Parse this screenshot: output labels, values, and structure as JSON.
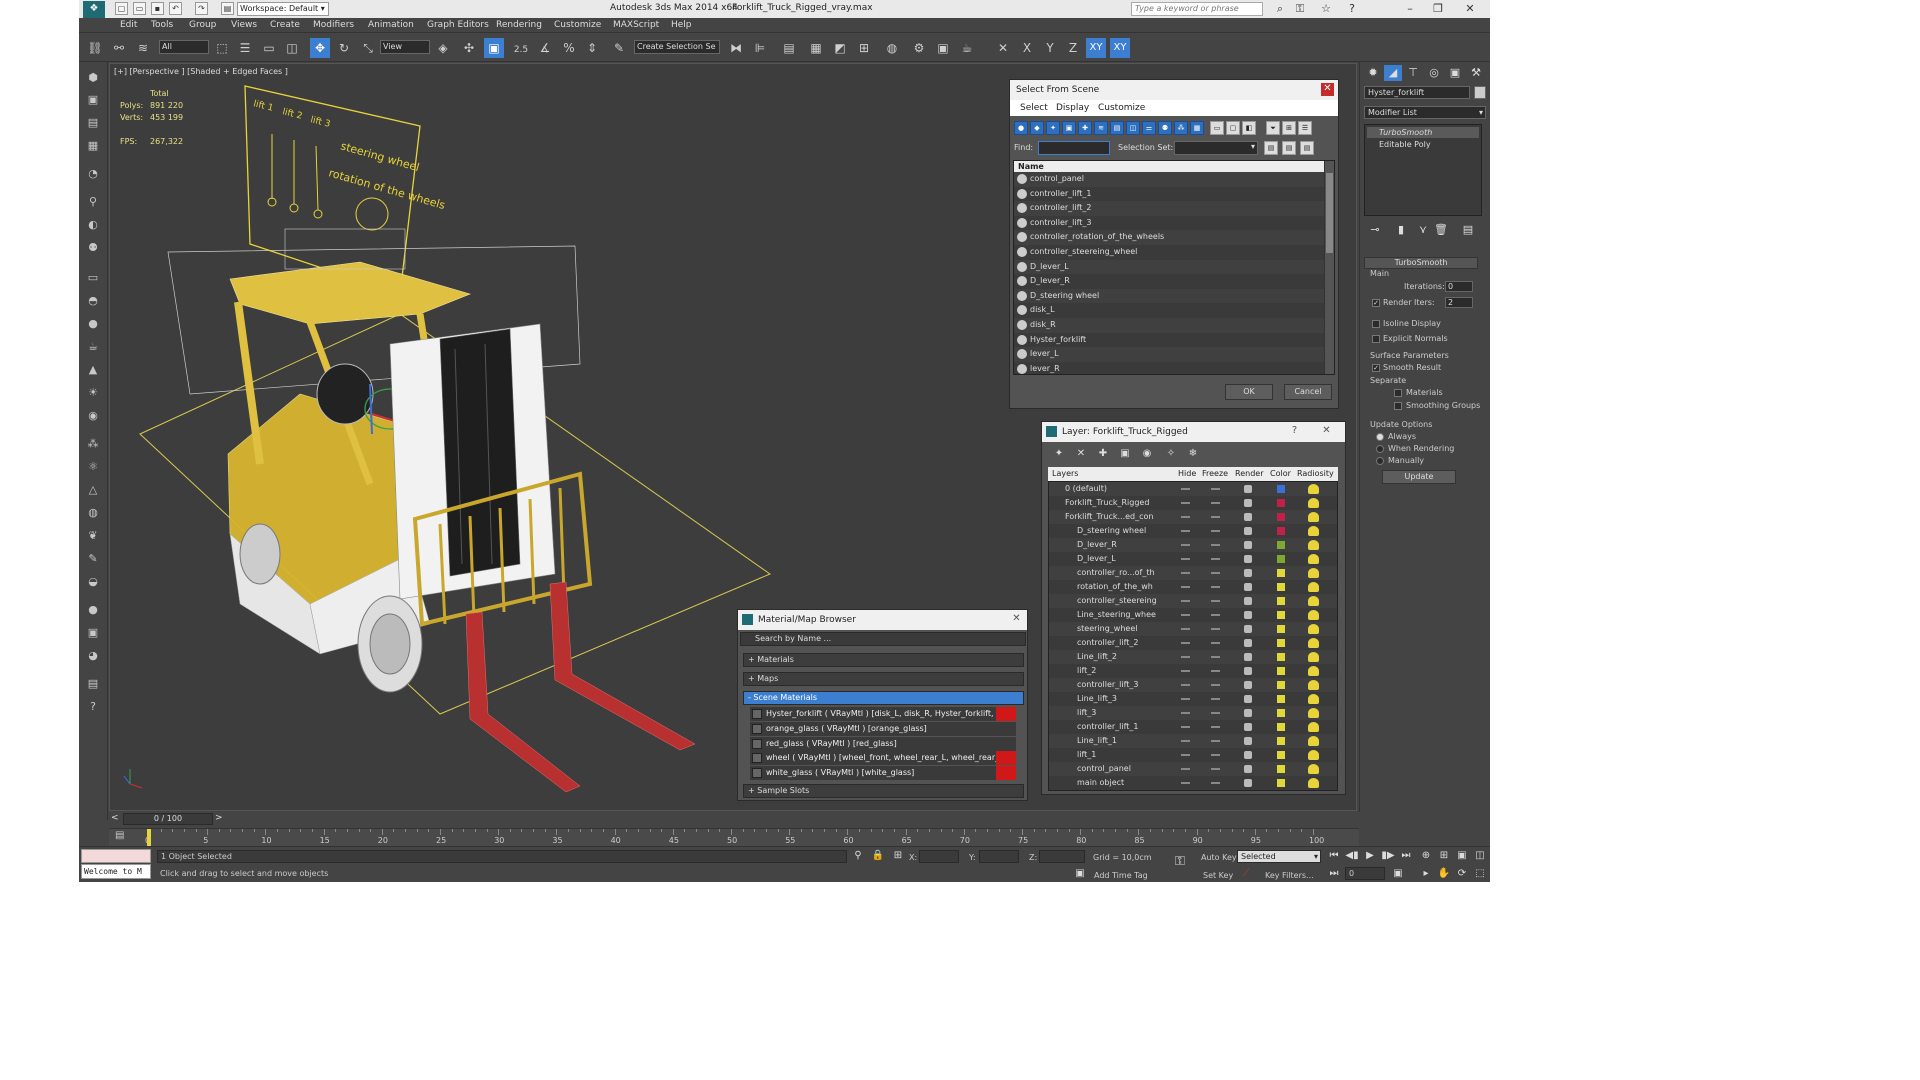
{
  "titlebar": {
    "workspace": "Workspace: Default",
    "app_title": "Autodesk 3ds Max  2014 x64",
    "file": "Forklift_Truck_Rigged_vray.max",
    "search_placeholder": "Type a keyword or phrase"
  },
  "menu": [
    "Edit",
    "Tools",
    "Group",
    "Views",
    "Create",
    "Modifiers",
    "Animation",
    "Graph Editors",
    "Rendering",
    "Customize",
    "MAXScript",
    "Help"
  ],
  "toolbar": {
    "filter_value": "All",
    "refcoord_value": "View",
    "selection_set_value": "Create Selection Se",
    "axes": [
      "X",
      "Y",
      "Z",
      "XY",
      "XY"
    ],
    "snap_label": "2.5"
  },
  "viewport": {
    "label": "[+] [Perspective ] [Shaded + Edged Faces ]",
    "stats_total": "Total",
    "polys_label": "Polys:",
    "polys_value": "891 220",
    "verts_label": "Verts:",
    "verts_value": "453 199",
    "fps_label": "FPS:",
    "fps_value": "267,322",
    "panel_text_1": "steering wheel",
    "panel_text_2": "rotation of the wheels",
    "panel_nums": [
      "lift 1",
      "lift 2",
      "lift 3"
    ]
  },
  "select_from_scene": {
    "title": "Select From Scene",
    "menu": [
      "Select",
      "Display",
      "Customize"
    ],
    "find_label": "Find:",
    "selection_set_label": "Selection Set:",
    "column_name": "Name",
    "items": [
      "control_panel",
      "controller_lift_1",
      "controller_lift_2",
      "controller_lift_3",
      "controller_rotation_of_the_wheels",
      "controller_steereing_wheel",
      "D_lever_L",
      "D_lever_R",
      "D_steering wheel",
      "disk_L",
      "disk_R",
      "Hyster_forklift",
      "lever_L",
      "lever_R"
    ],
    "ok": "OK",
    "cancel": "Cancel"
  },
  "layer_dialog": {
    "title": "Layer: Forklift_Truck_Rigged",
    "help": "?",
    "columns": [
      "Layers",
      "Hide",
      "Freeze",
      "Render",
      "Color",
      "Radiosity"
    ],
    "layers": [
      {
        "name": "0 (default)",
        "color": "#3a6fd8",
        "level": 0
      },
      {
        "name": "Forklift_Truck_Rigged",
        "color": "#c0204a",
        "level": 0
      },
      {
        "name": "Forklift_Truck...ed_con",
        "color": "#c0204a",
        "level": 0
      },
      {
        "name": "D_steering wheel",
        "color": "#c0204a",
        "level": 1
      },
      {
        "name": "D_lever_R",
        "color": "#7da832",
        "level": 1
      },
      {
        "name": "D_lever_L",
        "color": "#7da832",
        "level": 1
      },
      {
        "name": "controller_ro...of_th",
        "color": "#e0d83a",
        "level": 1
      },
      {
        "name": "rotation_of_the_wh",
        "color": "#e0d83a",
        "level": 1
      },
      {
        "name": "controller_steereing",
        "color": "#e0d83a",
        "level": 1
      },
      {
        "name": "Line_steering_whee",
        "color": "#e0d83a",
        "level": 1
      },
      {
        "name": "steering_wheel",
        "color": "#e0d83a",
        "level": 1
      },
      {
        "name": "controller_lift_2",
        "color": "#e0d83a",
        "level": 1
      },
      {
        "name": "Line_lift_2",
        "color": "#e0d83a",
        "level": 1
      },
      {
        "name": "lift_2",
        "color": "#e0d83a",
        "level": 1
      },
      {
        "name": "controller_lift_3",
        "color": "#e0d83a",
        "level": 1
      },
      {
        "name": "Line_lift_3",
        "color": "#e0d83a",
        "level": 1
      },
      {
        "name": "lift_3",
        "color": "#e0d83a",
        "level": 1
      },
      {
        "name": "controller_lift_1",
        "color": "#e0d83a",
        "level": 1
      },
      {
        "name": "Line_lift_1",
        "color": "#e0d83a",
        "level": 1
      },
      {
        "name": "lift_1",
        "color": "#e0d83a",
        "level": 1
      },
      {
        "name": "control_panel",
        "color": "#e0d83a",
        "level": 1
      },
      {
        "name": "main object",
        "color": "#e0d83a",
        "level": 1
      }
    ]
  },
  "material_browser": {
    "title": "Material/Map Browser",
    "search_placeholder": "Search by Name ...",
    "sections": [
      "+ Materials",
      "+ Maps",
      "- Scene Materials"
    ],
    "scene_materials": [
      "Hyster_forklift  ( VRayMtl ) [disk_L, disk_R, Hyster_forklift, lever...",
      "orange_glass  ( VRayMtl ) [orange_glass]",
      "red_glass  ( VRayMtl ) [red_glass]",
      "wheel  ( VRayMtl ) [wheel_front, wheel_rear_L, wheel_rear_R]",
      "white_glass  ( VRayMtl ) [white_glass]"
    ],
    "sample_slots": "+ Sample Slots"
  },
  "command_panel": {
    "object_name": "Hyster_forklift",
    "modifier_list": "Modifier List",
    "stack": [
      "TurboSmooth",
      "Editable Poly"
    ],
    "rollout_title": "TurboSmooth",
    "main_label": "Main",
    "iterations_label": "Iterations:",
    "iterations_value": "0",
    "render_iters_label": "Render Iters:",
    "render_iters_value": "2",
    "isoline": "Isoline Display",
    "explicit": "Explicit Normals",
    "surface_params": "Surface Parameters",
    "smooth_result": "Smooth Result",
    "separate": "Separate",
    "materials": "Materials",
    "smoothing_groups": "Smoothing Groups",
    "update_options": "Update Options",
    "always": "Always",
    "when_rendering": "When Rendering",
    "manually": "Manually",
    "update_btn": "Update"
  },
  "timeline": {
    "frame": "0 / 100",
    "ticks": [
      "0",
      "5",
      "10",
      "15",
      "20",
      "25",
      "30",
      "35",
      "40",
      "45",
      "50",
      "55",
      "60",
      "65",
      "70",
      "75",
      "80",
      "85",
      "90",
      "95",
      "100"
    ]
  },
  "status": {
    "maxscript": "Welcome to M",
    "selected": "1 Object Selected",
    "hint": "Click and drag to select and move objects",
    "x_label": "X:",
    "y_label": "Y:",
    "z_label": "Z:",
    "grid": "Grid = 10,0cm",
    "add_time_tag": "Add Time Tag",
    "auto_key": "Auto Key",
    "set_key": "Set Key",
    "selected_dropdown": "Selected",
    "key_filters": "Key Filters...",
    "frame_field": "0"
  },
  "colors": {
    "accent": "#3c7fd0",
    "wire_yellow": "#e8d33a",
    "fork_red": "#b83030"
  }
}
